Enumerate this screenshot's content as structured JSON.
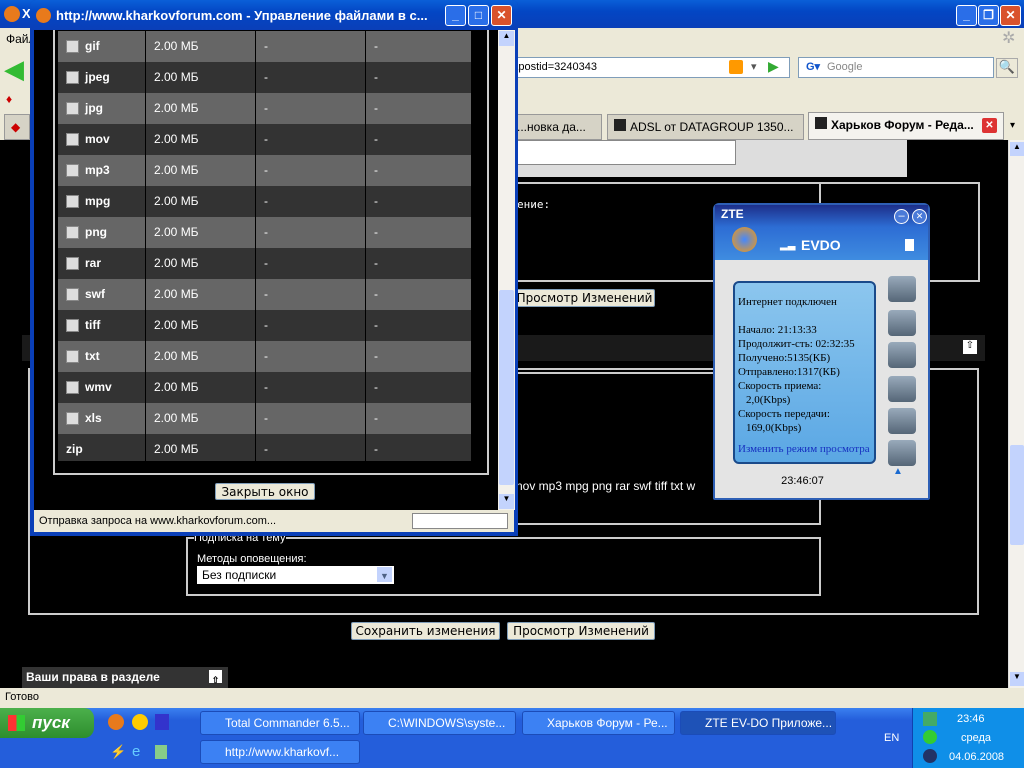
{
  "main_window": {
    "title_fragment": "Х",
    "menu_first": "Файл",
    "url_fragment": "&postid=3240343",
    "search_placeholder": "Google",
    "tabs": [
      {
        "label": "...новка да..."
      },
      {
        "label": "ADSL от DATAGROUP 1350..."
      },
      {
        "label": "Харьков Форум - Реда..."
      }
    ],
    "status": "Готово"
  },
  "page": {
    "fieldset_label_fragment": "ение:",
    "preview_button": "Просмотр Изменений",
    "extensions_fragment": "nov mp3 mpg png rar swf tiff txt w",
    "subscription_legend": "Подписка на тему",
    "notify_label": "Методы оповещения:",
    "notify_value": "Без подписки",
    "save_button": "Сохранить изменения",
    "preview_button2": "Просмотр Изменений",
    "rights_header": "Ваши права в разделе"
  },
  "popup": {
    "title": "http://www.kharkovforum.com - Управление файлами в с...",
    "close_button": "Закрыть окно",
    "status": "Отправка запроса на www.kharkovforum.com...",
    "rows": [
      {
        "ext": "gif",
        "size": "2.00 МБ",
        "w": "-",
        "h": "-"
      },
      {
        "ext": "jpeg",
        "size": "2.00 МБ",
        "w": "-",
        "h": "-"
      },
      {
        "ext": "jpg",
        "size": "2.00 МБ",
        "w": "-",
        "h": "-"
      },
      {
        "ext": "mov",
        "size": "2.00 МБ",
        "w": "-",
        "h": "-"
      },
      {
        "ext": "mp3",
        "size": "2.00 МБ",
        "w": "-",
        "h": "-"
      },
      {
        "ext": "mpg",
        "size": "2.00 МБ",
        "w": "-",
        "h": "-"
      },
      {
        "ext": "png",
        "size": "2.00 МБ",
        "w": "-",
        "h": "-"
      },
      {
        "ext": "rar",
        "size": "2.00 МБ",
        "w": "-",
        "h": "-"
      },
      {
        "ext": "swf",
        "size": "2.00 МБ",
        "w": "-",
        "h": "-"
      },
      {
        "ext": "tiff",
        "size": "2.00 МБ",
        "w": "-",
        "h": "-"
      },
      {
        "ext": "txt",
        "size": "2.00 МБ",
        "w": "-",
        "h": "-"
      },
      {
        "ext": "wmv",
        "size": "2.00 МБ",
        "w": "-",
        "h": "-"
      },
      {
        "ext": "xls",
        "size": "2.00 МБ",
        "w": "-",
        "h": "-"
      },
      {
        "ext": "zip",
        "size": "2.00 МБ",
        "w": "-",
        "h": "-"
      }
    ]
  },
  "zte": {
    "title": "ZTE",
    "network": "EVDO",
    "status": "Интернет подключен",
    "start": "Начало: 21:13:33",
    "duration": "Продолжит-сть: 02:32:35",
    "received": "Получено:5135(КБ)",
    "sent": "Отправлено:1317(КБ)",
    "rx_label": "Скорость приема:",
    "rx": "2,0(Kbps)",
    "tx_label": "Скорость передачи:",
    "tx": "169,0(Kbps)",
    "change_view": "Изменить режим просмотра",
    "clock": "23:46:07"
  },
  "taskbar": {
    "start": "пуск",
    "tasks": [
      {
        "label": "Total Commander 6.5..."
      },
      {
        "label": "C:\\WINDOWS\\syste..."
      },
      {
        "label": "Харьков Форум - Ре..."
      },
      {
        "label": "ZTE EV-DO Приложе..."
      },
      {
        "label": "http://www.kharkovf..."
      }
    ],
    "lang": "EN",
    "time": "23:46",
    "day": "среда",
    "date": "04.06.2008"
  }
}
